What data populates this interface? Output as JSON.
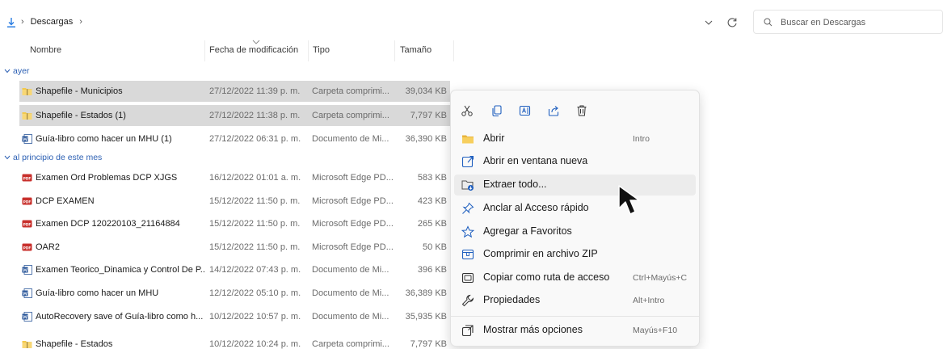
{
  "address": {
    "crumbs": [
      "Descargas"
    ],
    "separator": "›"
  },
  "search": {
    "placeholder": "Buscar en Descargas"
  },
  "columns": {
    "name": "Nombre",
    "date": "Fecha de modificación",
    "type": "Tipo",
    "size": "Tamaño"
  },
  "groups": [
    {
      "label": "ayer",
      "rows": [
        {
          "icon": "zip-folder-icon",
          "name": "Shapefile - Municipios",
          "date": "27/12/2022 11:39 p. m.",
          "type": "Carpeta comprimi...",
          "size": "39,034 KB",
          "selected": true
        },
        {
          "icon": "zip-folder-icon",
          "name": "Shapefile - Estados (1)",
          "date": "27/12/2022 11:38 p. m.",
          "type": "Carpeta comprimi...",
          "size": "7,797 KB",
          "selected": true
        },
        {
          "icon": "word-doc-icon",
          "name": "Guía-libro como hacer un MHU (1)",
          "date": "27/12/2022 06:31 p. m.",
          "type": "Documento de Mi...",
          "size": "36,390 KB",
          "selected": false
        }
      ]
    },
    {
      "label": "al principio de este mes",
      "rows": [
        {
          "icon": "pdf-icon",
          "name": "Examen Ord Problemas DCP XJGS",
          "date": "16/12/2022 01:01 a. m.",
          "type": "Microsoft Edge PD...",
          "size": "583 KB",
          "selected": false
        },
        {
          "icon": "pdf-icon",
          "name": "DCP EXAMEN",
          "date": "15/12/2022 11:50 p. m.",
          "type": "Microsoft Edge PD...",
          "size": "423 KB",
          "selected": false
        },
        {
          "icon": "pdf-icon",
          "name": "Examen DCP 120220103_21164884",
          "date": "15/12/2022 11:50 p. m.",
          "type": "Microsoft Edge PD...",
          "size": "265 KB",
          "selected": false
        },
        {
          "icon": "pdf-icon",
          "name": "OAR2",
          "date": "15/12/2022 11:50 p. m.",
          "type": "Microsoft Edge PD...",
          "size": "50 KB",
          "selected": false
        },
        {
          "icon": "word-doc-icon",
          "name": "Examen Teorico_Dinamica y Control De P...",
          "date": "14/12/2022 07:43 p. m.",
          "type": "Documento de Mi...",
          "size": "396 KB",
          "selected": false
        },
        {
          "icon": "word-doc-icon",
          "name": "Guía-libro como hacer un MHU",
          "date": "12/12/2022 05:10 p. m.",
          "type": "Documento de Mi...",
          "size": "36,389 KB",
          "selected": false
        },
        {
          "icon": "word-doc-icon",
          "name": "AutoRecovery save of Guía-libro como h...",
          "date": "10/12/2022 10:57 p. m.",
          "type": "Documento de Mi...",
          "size": "35,935 KB",
          "selected": false
        },
        {
          "icon": "zip-folder-icon",
          "name": "Shapefile - Estados",
          "date": "10/12/2022 10:24 p. m.",
          "type": "Carpeta comprimi...",
          "size": "7,797 KB",
          "selected": false
        }
      ]
    }
  ],
  "context_menu": {
    "toolbar": [
      "cut-icon",
      "copy-icon",
      "rename-icon",
      "share-icon",
      "delete-icon"
    ],
    "items": [
      {
        "icon": "folder-icon",
        "label": "Abrir",
        "shortcut": "Intro",
        "hover": false
      },
      {
        "icon": "open-new-window-icon",
        "label": "Abrir en ventana nueva",
        "shortcut": "",
        "hover": false
      },
      {
        "icon": "extract-icon",
        "label": "Extraer todo...",
        "shortcut": "",
        "hover": true
      },
      {
        "icon": "pin-icon",
        "label": "Anclar al Acceso rápido",
        "shortcut": "",
        "hover": false
      },
      {
        "icon": "star-icon",
        "label": "Agregar a Favoritos",
        "shortcut": "",
        "hover": false
      },
      {
        "icon": "zip-icon",
        "label": "Comprimir en archivo ZIP",
        "shortcut": "",
        "hover": false
      },
      {
        "icon": "copy-path-icon",
        "label": "Copiar como ruta de acceso",
        "shortcut": "Ctrl+Mayús+C",
        "hover": false
      },
      {
        "icon": "wrench-icon",
        "label": "Propiedades",
        "shortcut": "Alt+Intro",
        "hover": false
      },
      {
        "icon": "more-options-icon",
        "label": "Mostrar más opciones",
        "shortcut": "Mayús+F10",
        "hover": false
      }
    ]
  },
  "colors": {
    "group_label": "#2b5fb3",
    "selection": "#d9d9d9",
    "menu_hover": "#ececec",
    "menu_icon_blue": "#1f5fbf"
  }
}
